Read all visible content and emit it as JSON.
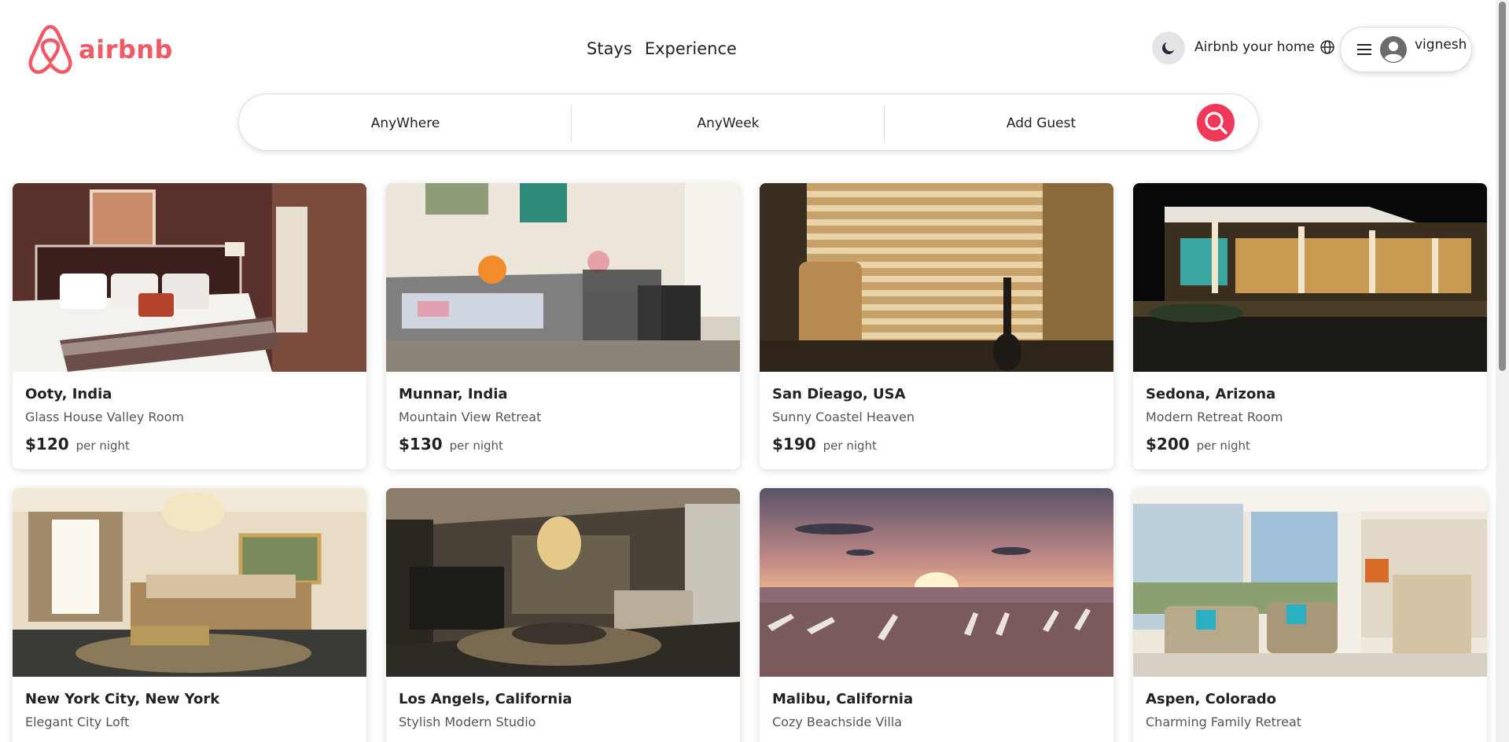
{
  "brand": {
    "name": "airbnb",
    "color": "#f05a67"
  },
  "nav": {
    "stays": "Stays",
    "experience": "Experience"
  },
  "header": {
    "host_label": "Airbnb your home",
    "user_name": "vignesh"
  },
  "icons": {
    "theme": "moon-icon",
    "globe": "globe-icon",
    "menu": "menu-icon",
    "avatar": "user-avatar-icon",
    "search": "search-icon"
  },
  "search": {
    "where": "AnyWhere",
    "week": "AnyWeek",
    "guest": "Add Guest",
    "button_color": "#f0385a"
  },
  "listings": [
    {
      "location": "Ooty, India",
      "title": "Glass House Valley Room",
      "price": "$120",
      "unit": "per night"
    },
    {
      "location": "Munnar, India",
      "title": "Mountain View Retreat",
      "price": "$130",
      "unit": "per night"
    },
    {
      "location": "San Dieago, USA",
      "title": "Sunny Coastel Heaven",
      "price": "$190",
      "unit": "per night"
    },
    {
      "location": "Sedona, Arizona",
      "title": "Modern Retreat Room",
      "price": "$200",
      "unit": "per night"
    },
    {
      "location": "New York City, New York",
      "title": "Elegant City Loft",
      "price": "",
      "unit": ""
    },
    {
      "location": "Los Angels, California",
      "title": "Stylish Modern Studio",
      "price": "",
      "unit": ""
    },
    {
      "location": "Malibu, California",
      "title": "Cozy Beachside Villa",
      "price": "",
      "unit": ""
    },
    {
      "location": "Aspen, Colorado",
      "title": "Charming Family Retreat",
      "price": "",
      "unit": ""
    }
  ]
}
